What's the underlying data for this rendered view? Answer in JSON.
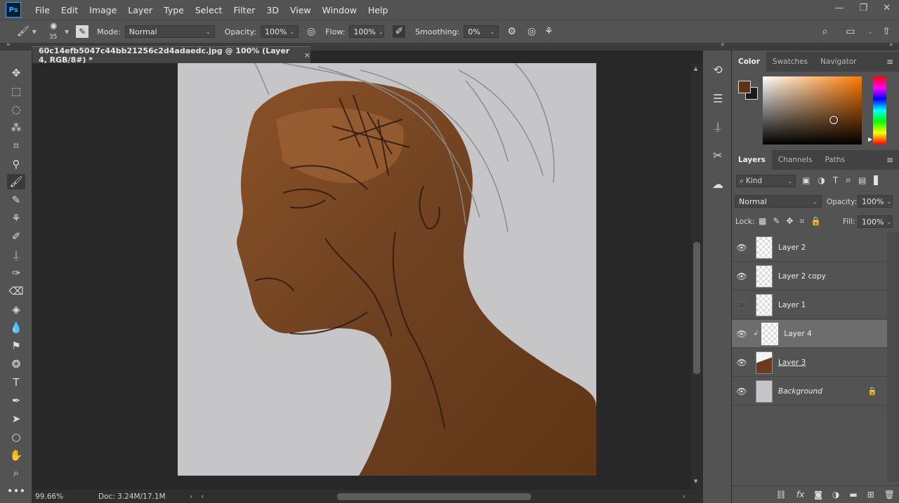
{
  "app": {
    "logo": "Ps"
  },
  "menu": [
    "File",
    "Edit",
    "Image",
    "Layer",
    "Type",
    "Select",
    "Filter",
    "3D",
    "View",
    "Window",
    "Help"
  ],
  "window_controls": {
    "minimize": "—",
    "restore": "❐",
    "close": "✕"
  },
  "options": {
    "brush_size": "35",
    "mode_label": "Mode:",
    "mode_value": "Normal",
    "opacity_label": "Opacity:",
    "opacity_value": "100%",
    "flow_label": "Flow:",
    "flow_value": "100%",
    "smoothing_label": "Smoothing:",
    "smoothing_value": "0%"
  },
  "document": {
    "tab_title": "60c14efb5047c44bb21256c2d4adaedc.jpg @ 100% (Layer 4, RGB/8#) *",
    "close": "×",
    "zoom": "99.66%",
    "doc_size": "Doc: 3.24M/17.1M"
  },
  "color_panel": {
    "tabs": [
      "Color",
      "Swatches",
      "Navigator"
    ],
    "foreground": "#5a3418",
    "background": "#1a1a1a"
  },
  "layers_panel": {
    "tabs": [
      "Layers",
      "Channels",
      "Paths"
    ],
    "filter_kind": "Kind",
    "blend_mode": "Normal",
    "opacity_label": "Opacity:",
    "opacity_value": "100%",
    "lock_label": "Lock:",
    "fill_label": "Fill:",
    "fill_value": "100%",
    "layers": [
      {
        "name": "Layer 2"
      },
      {
        "name": "Layer 2 copy"
      },
      {
        "name": "Layer 1"
      },
      {
        "name": "Layer 4"
      },
      {
        "name": "Layer 3"
      },
      {
        "name": "Background"
      }
    ]
  }
}
